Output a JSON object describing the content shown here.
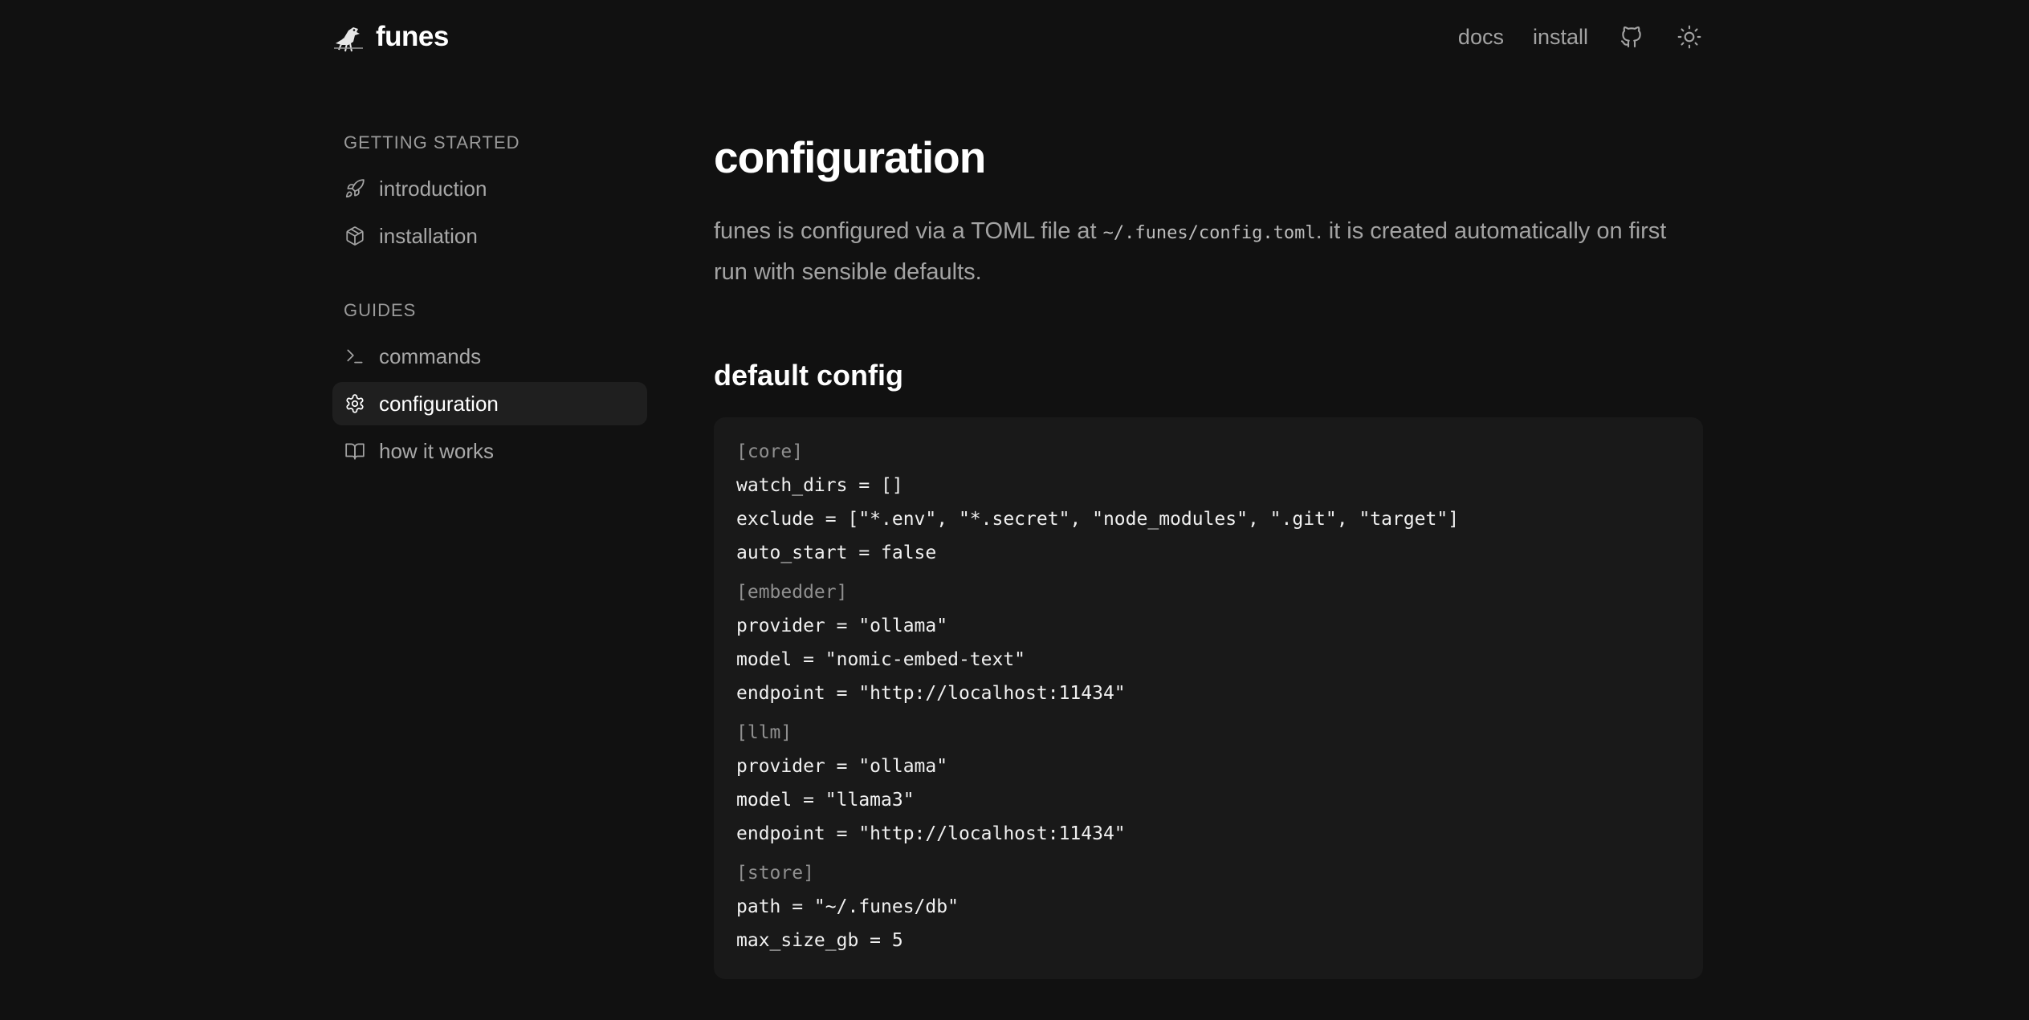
{
  "header": {
    "brand_name": "funes",
    "logo_icon": "bird-logo",
    "nav": [
      {
        "label": "docs"
      },
      {
        "label": "install"
      }
    ],
    "github_icon": "github-icon",
    "theme_icon": "sun-icon"
  },
  "sidebar": {
    "sections": [
      {
        "title": "GETTING STARTED",
        "items": [
          {
            "label": "introduction",
            "icon": "rocket-icon",
            "active": false
          },
          {
            "label": "installation",
            "icon": "package-icon",
            "active": false
          }
        ]
      },
      {
        "title": "GUIDES",
        "items": [
          {
            "label": "commands",
            "icon": "terminal-icon",
            "active": false
          },
          {
            "label": "configuration",
            "icon": "gear-icon",
            "active": true
          },
          {
            "label": "how it works",
            "icon": "book-icon",
            "active": false
          }
        ]
      }
    ]
  },
  "main": {
    "title": "configuration",
    "intro_before": "funes is configured via a TOML file at ",
    "intro_code": "~/.funes/config.toml",
    "intro_after": ". it is created automatically on first run with sensible defaults.",
    "section_title": "default config",
    "code": [
      {
        "text": "[core]",
        "kind": "head"
      },
      {
        "text": "watch_dirs = []",
        "kind": "line"
      },
      {
        "text": "exclude = [\"*.env\", \"*.secret\", \"node_modules\", \".git\", \"target\"]",
        "kind": "line"
      },
      {
        "text": "auto_start = false",
        "kind": "line"
      },
      {
        "text": "[embedder]",
        "kind": "head"
      },
      {
        "text": "provider = \"ollama\"",
        "kind": "line"
      },
      {
        "text": "model = \"nomic-embed-text\"",
        "kind": "line"
      },
      {
        "text": "endpoint = \"http://localhost:11434\"",
        "kind": "line"
      },
      {
        "text": "[llm]",
        "kind": "head"
      },
      {
        "text": "provider = \"ollama\"",
        "kind": "line"
      },
      {
        "text": "model = \"llama3\"",
        "kind": "line"
      },
      {
        "text": "endpoint = \"http://localhost:11434\"",
        "kind": "line"
      },
      {
        "text": "[store]",
        "kind": "head"
      },
      {
        "text": "path = \"~/.funes/db\"",
        "kind": "line"
      },
      {
        "text": "max_size_gb = 5",
        "kind": "line"
      }
    ]
  },
  "colors": {
    "background": "#111111",
    "code_background": "#191919",
    "active_item_background": "#1f1f1f",
    "muted_text": "#a3a3a3",
    "heading_text": "#ffffff"
  }
}
